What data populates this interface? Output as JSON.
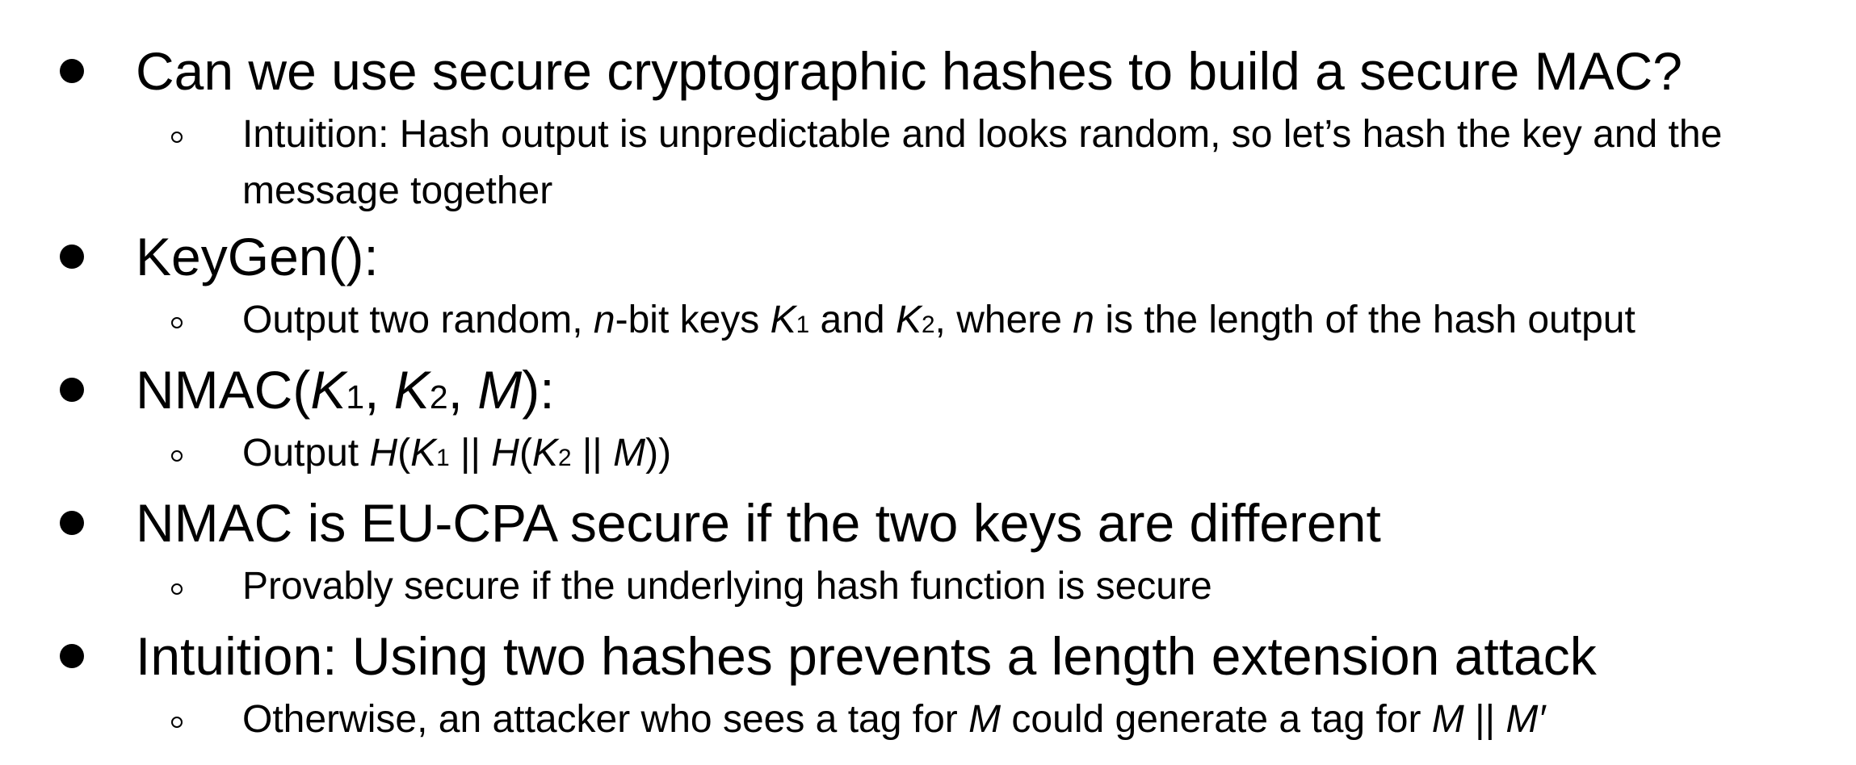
{
  "items": [
    {
      "title": "Can we use secure cryptographic hashes to build a secure MAC?",
      "sub": {
        "line1": "Intuition: Hash output is unpredictable and looks random, so let’s hash the key and the",
        "line2": "message together"
      }
    },
    {
      "title": "KeyGen():",
      "sub": {
        "t1": "Output two random, ",
        "n1": "n",
        "t2": "-bit keys ",
        "k": "K",
        "one": "1",
        "t3": " and ",
        "two": "2",
        "t4": ", where ",
        "n2": "n",
        "t5": " is the length of the hash output"
      }
    },
    {
      "title": {
        "t1": "NMAC(",
        "k": "K",
        "one": "1",
        "sep": ", ",
        "two": "2",
        "m": "M",
        "t2": "):"
      },
      "sub": {
        "t1": "Output ",
        "h": "H",
        "paren": "(",
        "k": "K",
        "one": "1",
        "bars": " || ",
        "two": "2",
        "m": "M",
        "close": "))"
      }
    },
    {
      "title": "NMAC is EU-CPA secure if the two keys are different",
      "sub": "Provably secure if the underlying hash function is secure"
    },
    {
      "title": "Intuition: Using two hashes prevents a length extension attack",
      "sub": {
        "t1": "Otherwise, an attacker who sees a tag for ",
        "m": "M",
        "t2": " could generate a tag for ",
        "bars": " || ",
        "mprime": "M′"
      }
    }
  ]
}
